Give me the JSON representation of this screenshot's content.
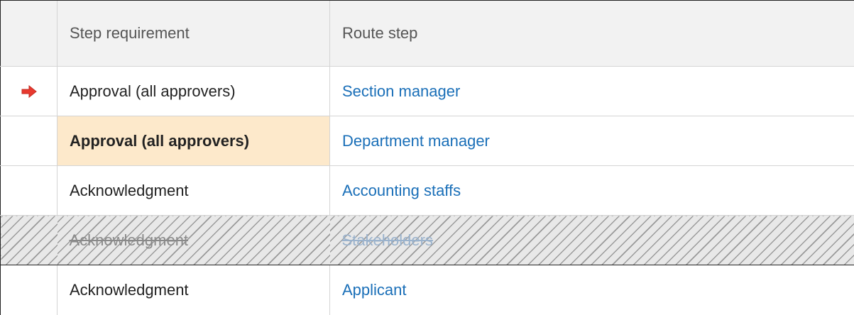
{
  "table": {
    "headers": {
      "requirement": "Step requirement",
      "route_step": "Route step"
    },
    "rows": [
      {
        "requirement": "Approval (all approvers)",
        "route_step": "Section manager"
      },
      {
        "requirement": "Approval (all approvers)",
        "route_step": "Department manager"
      },
      {
        "requirement": "Acknowledgment",
        "route_step": "Accounting staffs"
      },
      {
        "requirement": "Acknowledgment",
        "route_step": "Stakeholders"
      },
      {
        "requirement": "Acknowledgment",
        "route_step": "Applicant"
      }
    ]
  },
  "icons": {
    "current_step": "red-right-arrow-icon"
  },
  "colors": {
    "link": "#1a6fb8",
    "current_highlight": "#fde9cb",
    "arrow": "#e8392f",
    "skipped_text": "#8a8a8a"
  }
}
